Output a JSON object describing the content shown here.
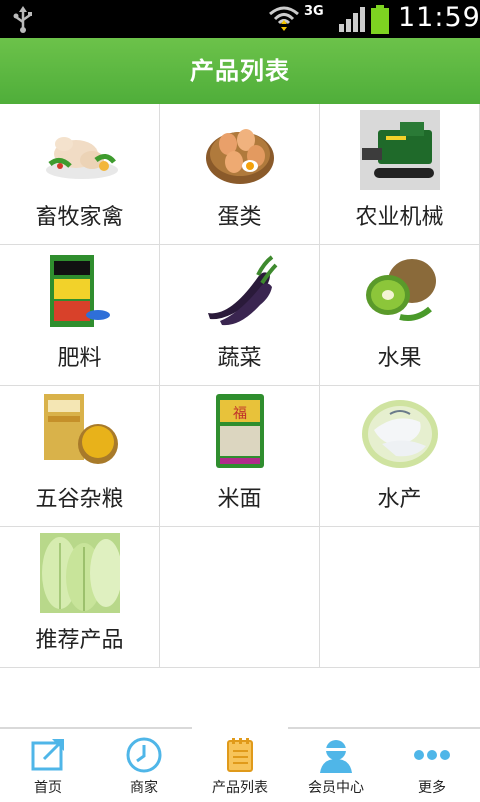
{
  "status_bar": {
    "network": "3G",
    "time": "11:59"
  },
  "header": {
    "title": "产品列表"
  },
  "categories": [
    {
      "label": "畜牧家禽",
      "icon": "poultry-image"
    },
    {
      "label": "蛋类",
      "icon": "eggs-image"
    },
    {
      "label": "农业机械",
      "icon": "harvester-image"
    },
    {
      "label": "肥料",
      "icon": "fertilizer-image"
    },
    {
      "label": "蔬菜",
      "icon": "eggplant-image"
    },
    {
      "label": "水果",
      "icon": "kiwi-image"
    },
    {
      "label": "五谷杂粮",
      "icon": "millet-image"
    },
    {
      "label": "米面",
      "icon": "rice-bag-image"
    },
    {
      "label": "水产",
      "icon": "fish-image"
    },
    {
      "label": "推荐产品",
      "icon": "cabbage-image"
    }
  ],
  "bottom_nav": [
    {
      "label": "首页",
      "icon": "home-share-icon"
    },
    {
      "label": "商家",
      "icon": "clock-icon"
    },
    {
      "label": "产品列表",
      "icon": "list-notebook-icon",
      "active": true
    },
    {
      "label": "会员中心",
      "icon": "member-icon"
    },
    {
      "label": "更多",
      "icon": "more-dots-icon"
    }
  ],
  "colors": {
    "header_green": "#5cb843",
    "nav_icon_blue": "#4fb6e8",
    "active_icon_orange": "#f0a020"
  }
}
